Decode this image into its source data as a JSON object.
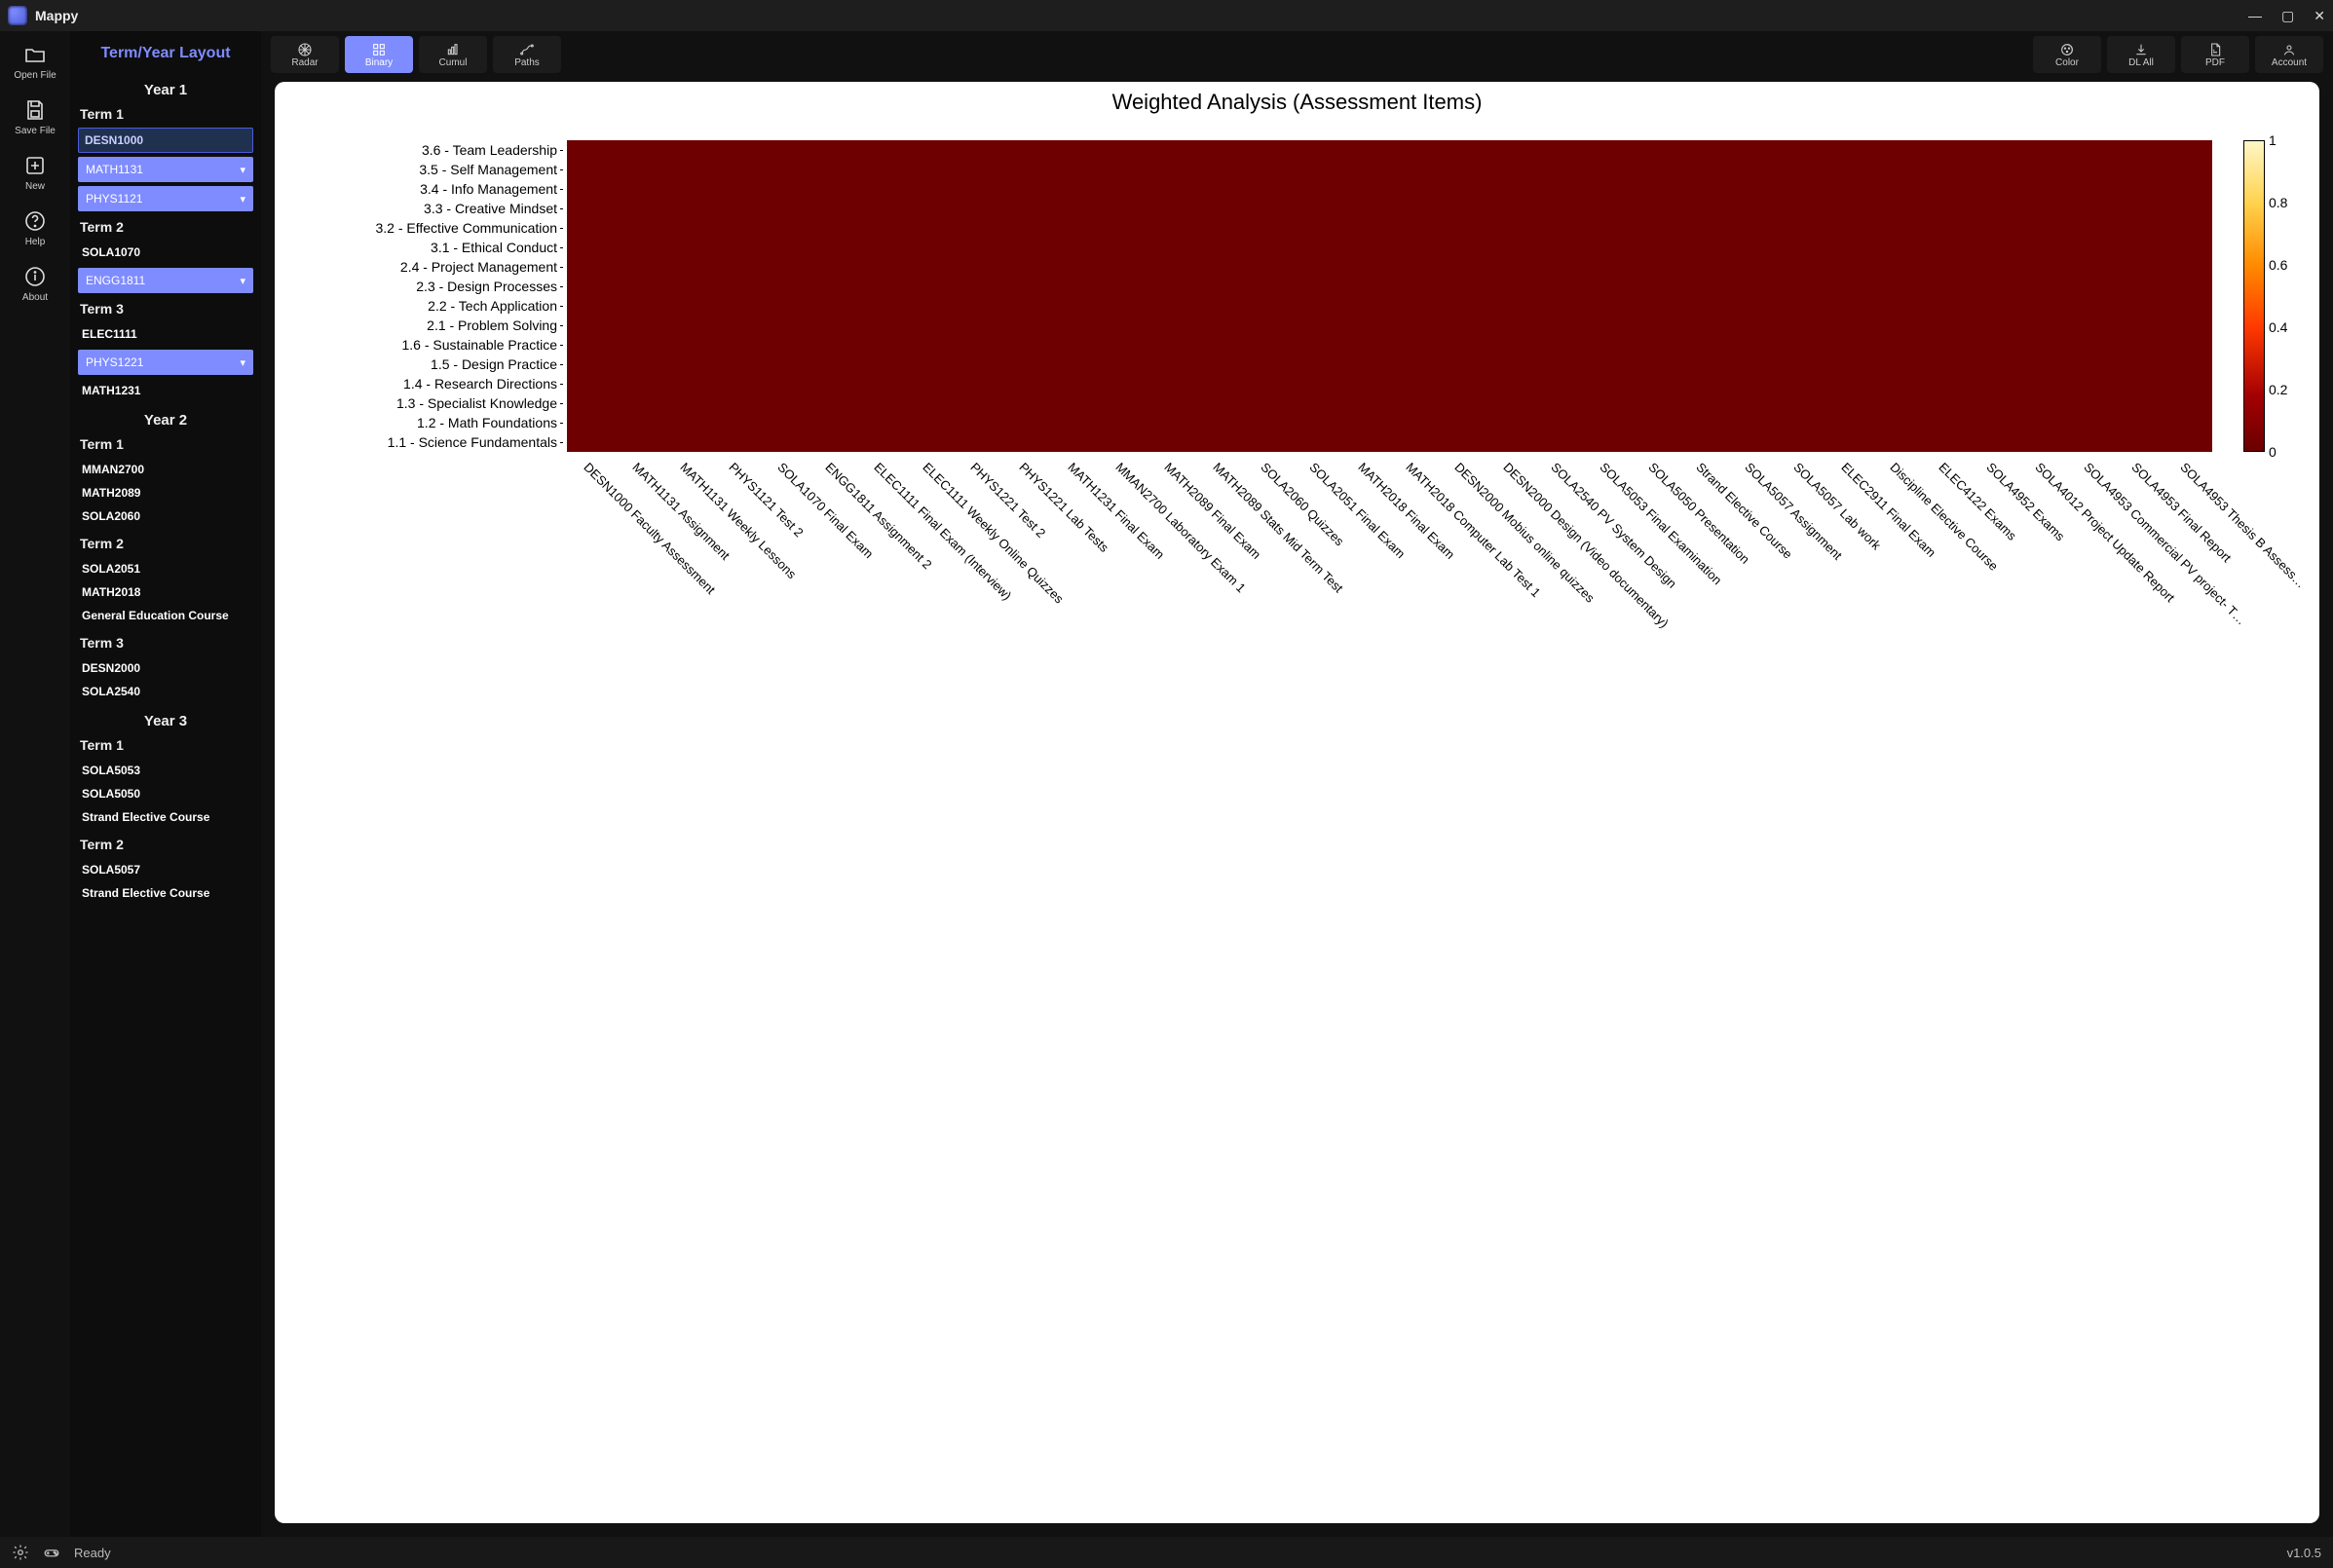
{
  "app": {
    "name": "Mappy",
    "version": "v1.0.5",
    "status": "Ready"
  },
  "window_controls": {
    "min": "—",
    "max": "▢",
    "close": "✕"
  },
  "rail": [
    {
      "id": "open-file",
      "label": "Open File"
    },
    {
      "id": "save-file",
      "label": "Save File"
    },
    {
      "id": "new",
      "label": "New"
    },
    {
      "id": "help",
      "label": "Help"
    },
    {
      "id": "about",
      "label": "About"
    }
  ],
  "sidebar": {
    "title": "Term/Year Layout",
    "years": [
      {
        "name": "Year 1",
        "terms": [
          {
            "name": "Term 1",
            "items": [
              {
                "label": "DESN1000",
                "kind": "selected"
              },
              {
                "label": "MATH1131",
                "kind": "dropdown"
              },
              {
                "label": "PHYS1121",
                "kind": "dropdown"
              }
            ]
          },
          {
            "name": "Term 2",
            "items": [
              {
                "label": "SOLA1070",
                "kind": "plain"
              },
              {
                "label": "ENGG1811",
                "kind": "dropdown"
              }
            ]
          },
          {
            "name": "Term 3",
            "items": [
              {
                "label": "ELEC1111",
                "kind": "plain"
              },
              {
                "label": "PHYS1221",
                "kind": "dropdown"
              },
              {
                "label": "MATH1231",
                "kind": "plain"
              }
            ]
          }
        ]
      },
      {
        "name": "Year 2",
        "terms": [
          {
            "name": "Term 1",
            "items": [
              {
                "label": "MMAN2700",
                "kind": "plain"
              },
              {
                "label": "MATH2089",
                "kind": "plain"
              },
              {
                "label": "SOLA2060",
                "kind": "plain"
              }
            ]
          },
          {
            "name": "Term 2",
            "items": [
              {
                "label": "SOLA2051",
                "kind": "plain"
              },
              {
                "label": "MATH2018",
                "kind": "plain"
              },
              {
                "label": "General Education Course",
                "kind": "plain"
              }
            ]
          },
          {
            "name": "Term 3",
            "items": [
              {
                "label": "DESN2000",
                "kind": "plain"
              },
              {
                "label": "SOLA2540",
                "kind": "plain"
              }
            ]
          }
        ]
      },
      {
        "name": "Year 3",
        "terms": [
          {
            "name": "Term 1",
            "items": [
              {
                "label": "SOLA5053",
                "kind": "plain"
              },
              {
                "label": "SOLA5050",
                "kind": "plain"
              },
              {
                "label": "Strand Elective Course",
                "kind": "plain"
              }
            ]
          },
          {
            "name": "Term 2",
            "items": [
              {
                "label": "SOLA5057",
                "kind": "plain"
              },
              {
                "label": "Strand Elective Course",
                "kind": "plain"
              }
            ]
          }
        ]
      }
    ]
  },
  "toolbar": {
    "views": [
      {
        "id": "radar",
        "label": "Radar"
      },
      {
        "id": "binary",
        "label": "Binary",
        "active": true
      },
      {
        "id": "cumul",
        "label": "Cumul"
      },
      {
        "id": "paths",
        "label": "Paths"
      }
    ],
    "right": [
      {
        "id": "color",
        "label": "Color"
      },
      {
        "id": "dlall",
        "label": "DL All"
      },
      {
        "id": "pdf",
        "label": "PDF"
      },
      {
        "id": "account",
        "label": "Account"
      }
    ]
  },
  "chart_data": {
    "type": "heatmap",
    "title": "Weighted Analysis (Assessment Items)",
    "legend_ticks": [
      "1",
      "0.8",
      "0.6",
      "0.4",
      "0.2",
      "0"
    ],
    "ylabels": [
      "3.6 - Team Leadership",
      "3.5 - Self Management",
      "3.4 - Info Management",
      "3.3 - Creative Mindset",
      "3.2 - Effective Communication",
      "3.1 - Ethical Conduct",
      "2.4 - Project Management",
      "2.3 - Design Processes",
      "2.2 - Tech Application",
      "2.1 - Problem Solving",
      "1.6 - Sustainable Practice",
      "1.5 - Design Practice",
      "1.4 - Research Directions",
      "1.3 - Specialist Knowledge",
      "1.2 - Math Foundations",
      "1.1 - Science Fundamentals"
    ],
    "xlabels": [
      "DESN1000 Faculty Assessment",
      "MATH1131 Assignment",
      "MATH1131 Weekly Lessons",
      "PHYS1121 Test 2",
      "SOLA1070 Final Exam",
      "ENGG1811 Assignment 2",
      "ELEC1111 Final Exam (Interview)",
      "ELEC1111 Weekly Online Quizzes",
      "PHYS1221 Test 2",
      "PHYS1221 Lab Tests",
      "MATH1231 Final Exam",
      "MMAN2700 Laboratory Exam 1",
      "MATH2089 Final Exam",
      "MATH2089 Stats Mid Term Test",
      "SOLA2060 Quizzes",
      "SOLA2051 Final Exam",
      "MATH2018 Final Exam",
      "MATH2018 Computer Lab Test 1",
      "DESN2000 Mobius online quizzes",
      "DESN2000 Design (Video documentary)",
      "SOLA2540 PV System Design",
      "SOLA5053 Final Examination",
      "SOLA5050 Presentation",
      "Strand Elective Course",
      "SOLA5057 Assignment",
      "SOLA5057 Lab work",
      "ELEC2911 Final Exam",
      "Discipline Elective Course",
      "ELEC4122 Exams",
      "SOLA4952 Exams",
      "SOLA4012 Project Update Report",
      "SOLA4953 Commercial PV project- T…",
      "SOLA4953 Final Report",
      "SOLA4953 Thesis B Assess…"
    ],
    "note": "Approximate cell intensities 0–1 estimated from colour gradient; rows ordered top→bottom as ylabels, cols left→right as xlabels (subset of columns; screenshot displays ~80+ columns).",
    "ncols": 80
  }
}
